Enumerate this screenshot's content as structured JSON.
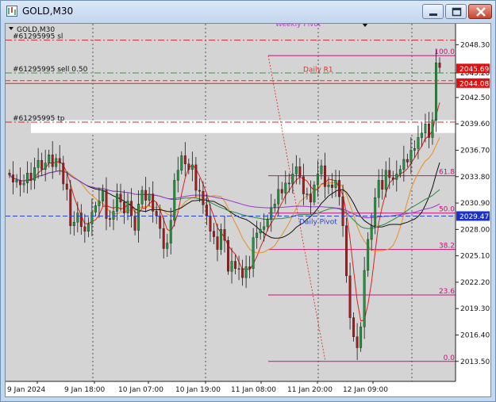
{
  "window": {
    "title": "GOLD,M30",
    "buttons": {
      "minimize": "minimize",
      "maximize": "maximize",
      "close": "close"
    }
  },
  "chart_header": {
    "symbol": "GOLD,M30",
    "top_label": "Weekly Pivot"
  },
  "orders": [
    {
      "label": "#61295995 sl",
      "price": 2048.8,
      "color": "#d62828",
      "style": "dashdot"
    },
    {
      "label": "#61295995 sell 0.50",
      "price": 2045.2,
      "color": "#2e9e44",
      "style": "dashdot"
    },
    {
      "label": "#61295995 tp",
      "price": 2039.8,
      "color": "#d62828",
      "style": "dashdot"
    }
  ],
  "pivots": [
    {
      "label": "Daily R1",
      "price": 2044.35,
      "color": "#e03030"
    },
    {
      "label": "Daily Pivot",
      "price": 2029.47,
      "color": "#2a44d0"
    }
  ],
  "price_axis": {
    "ticks": [
      "2048.30",
      "2045.20",
      "2042.50",
      "2039.60",
      "2036.70",
      "2033.80",
      "2030.90",
      "2028.00",
      "2025.10",
      "2022.20",
      "2019.30",
      "2016.40",
      "2013.50"
    ],
    "badges": [
      {
        "text": "2045.69",
        "price": 2045.69,
        "color": "#e01010"
      },
      {
        "text": "2044.08",
        "price": 2044.08,
        "color": "#e01010"
      },
      {
        "text": "2029.47",
        "price": 2029.47,
        "color": "#1a2fd0"
      }
    ]
  },
  "time_axis": {
    "ticks": [
      "9 Jan 2024",
      "9 Jan 18:00",
      "10 Jan 07:00",
      "10 Jan 19:00",
      "11 Jan 08:00",
      "11 Jan 20:00",
      "12 Jan 09:00"
    ]
  },
  "fibonacci": {
    "color": "#c8107a",
    "levels": [
      {
        "label": "100.0",
        "price": 2047.1
      },
      {
        "label": "61.8",
        "price": 2033.9
      },
      {
        "label": "50.0",
        "price": 2029.8
      },
      {
        "label": "38.2",
        "price": 2025.8
      },
      {
        "label": "23.6",
        "price": 2020.8
      },
      {
        "label": "0.0",
        "price": 2013.5
      }
    ]
  },
  "colors": {
    "chart_bg": "#d4d4d4",
    "bull": "#1a9a3a",
    "bear": "#b01818",
    "ma_fast": "#e02020",
    "ma_orange": "#e8901e",
    "ma_black": "#111111",
    "ma_green": "#2a8a4a",
    "ma_purple": "#9a3ac8"
  },
  "chart_data": {
    "type": "candlestick",
    "symbol": "GOLD",
    "timeframe": "M30",
    "ylim": [
      2011.3,
      2050.6
    ],
    "candles_close": [
      2034.0,
      2033.2,
      2033.4,
      2032.9,
      2033.1,
      2034.2,
      2033.4,
      2034.8,
      2035.6,
      2034.6,
      2035.3,
      2036.2,
      2034.9,
      2035.8,
      2035.3,
      2033.0,
      2032.4,
      2028.4,
      2028.8,
      2029.8,
      2028.3,
      2027.8,
      2028.6,
      2029.9,
      2030.6,
      2031.1,
      2032.3,
      2029.2,
      2029.1,
      2030.0,
      2031.9,
      2031.0,
      2029.8,
      2031.1,
      2029.5,
      2027.9,
      2030.8,
      2032.3,
      2031.2,
      2031.9,
      2030.0,
      2029.5,
      2028.1,
      2025.9,
      2026.5,
      2029.0,
      2033.4,
      2034.5,
      2036.1,
      2035.2,
      2034.6,
      2035.1,
      2032.3,
      2032.2,
      2030.7,
      2029.5,
      2027.8,
      2027.2,
      2025.8,
      2028.0,
      2026.8,
      2023.4,
      2024.5,
      2023.7,
      2023.7,
      2022.7,
      2023.9,
      2023.7,
      2027.1,
      2027.6,
      2028.0,
      2028.3,
      2029.1,
      2030.4,
      2030.8,
      2032.4,
      2032.0,
      2033.1,
      2033.0,
      2034.1,
      2034.9,
      2033.8,
      2031.9,
      2031.9,
      2031.0,
      2032.9,
      2034.1,
      2035.0,
      2032.7,
      2032.9,
      2032.6,
      2033.4,
      2031.6,
      2028.4,
      2022.9,
      2018.3,
      2016.2,
      2015.0,
      2017.3,
      2023.5,
      2026.9,
      2028.4,
      2031.5,
      2033.4,
      2032.4,
      2034.5,
      2033.7,
      2033.5,
      2034.1,
      2034.6,
      2035.7,
      2035.4,
      2036.7,
      2036.9,
      2038.1,
      2038.6,
      2039.6,
      2038.1,
      2040.0,
      2046.3,
      2045.8
    ]
  }
}
